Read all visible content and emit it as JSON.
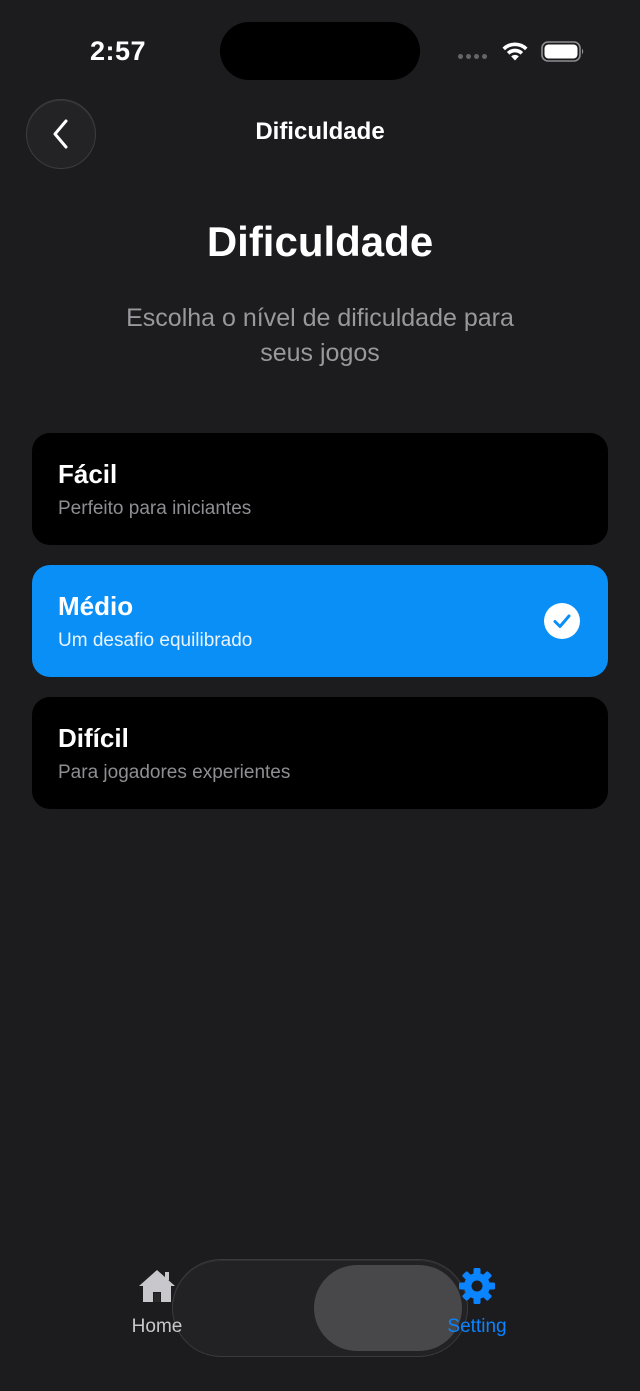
{
  "status_bar": {
    "time": "2:57",
    "icons": [
      "signal-icon",
      "wifi-icon",
      "battery-icon"
    ]
  },
  "nav": {
    "back_icon": "chevron-left-icon",
    "title": "Dificuldade"
  },
  "header": {
    "title": "Dificuldade",
    "subtitle": "Escolha o nível de dificuldade para seus jogos"
  },
  "options": [
    {
      "title": "Fácil",
      "description": "Perfeito para iniciantes",
      "selected": false
    },
    {
      "title": "Médio",
      "description": "Um desafio equilibrado",
      "selected": true
    },
    {
      "title": "Difícil",
      "description": "Para jogadores experientes",
      "selected": false
    }
  ],
  "tabs": [
    {
      "label": "Home",
      "icon": "house-icon",
      "active": false
    },
    {
      "label": "Setting",
      "icon": "gear-icon",
      "active": true
    }
  ],
  "colors": {
    "background": "#1c1c1e",
    "accent": "#0a8ff7",
    "card": "#000000",
    "secondary_text": "#8e8e93",
    "tab_active": "#0a84ff"
  }
}
